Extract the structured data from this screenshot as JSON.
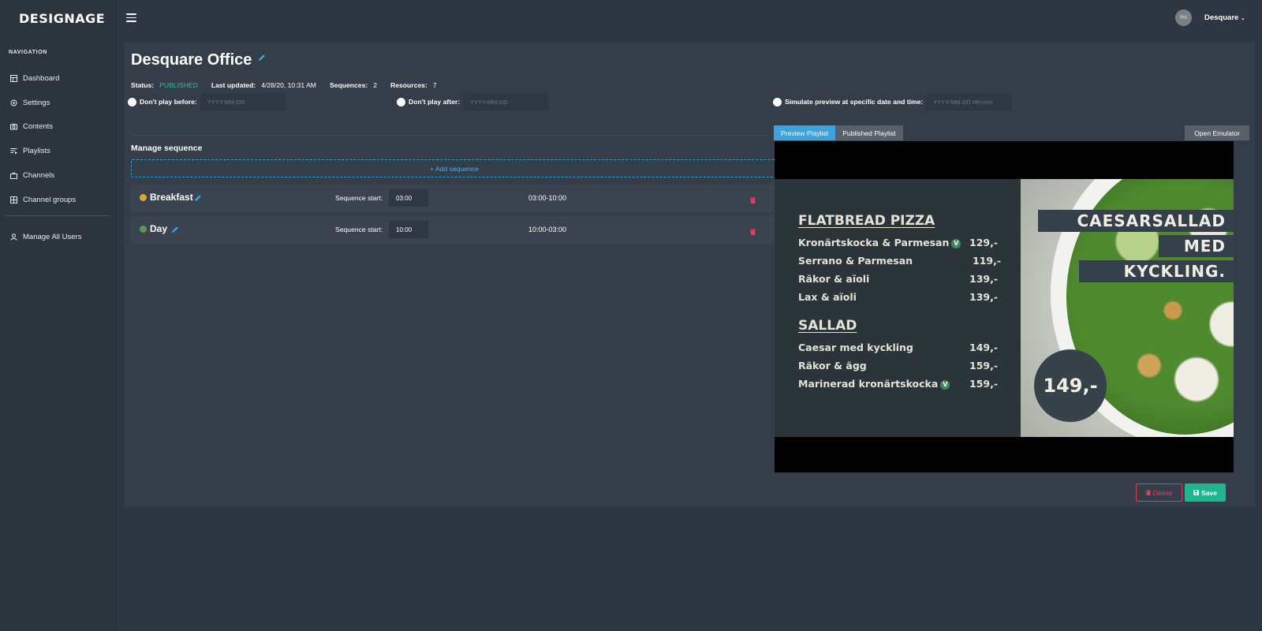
{
  "brand": {
    "logo": "DESIGNAGE"
  },
  "sidebar": {
    "heading": "NAVIGATION",
    "items": [
      {
        "label": "Dashboard",
        "icon": "dashboard-icon"
      },
      {
        "label": "Settings",
        "icon": "gear-icon"
      },
      {
        "label": "Contents",
        "icon": "camera-icon"
      },
      {
        "label": "Playlists",
        "icon": "playlist-icon"
      },
      {
        "label": "Channels",
        "icon": "tv-icon"
      },
      {
        "label": "Channel groups",
        "icon": "grid-icon"
      }
    ],
    "manage_users": "Manage All Users"
  },
  "topbar": {
    "avatar_initials": "RM",
    "user_name": "Desquare"
  },
  "page": {
    "title": "Desquare Office",
    "status_label": "Status:",
    "status_value": "PUBLISHED",
    "updated_label": "Last updated:",
    "updated_value": "4/28/20, 10:31 AM",
    "sequences_label": "Sequences:",
    "sequences_value": "2",
    "resources_label": "Resources:",
    "resources_value": "7",
    "before_label": "Don't play before:",
    "before_placeholder": "YYYY-MM-DD",
    "after_label": "Don't play after:",
    "after_placeholder": "YYYY-MM-DD",
    "simulate_label": "Simulate preview at specific date and time:",
    "simulate_placeholder": "YYYY-MM-DD HH:mm",
    "manage_title": "Manage sequence",
    "add_sequence": "+ Add sequence"
  },
  "sequences": [
    {
      "name": "Breakfast",
      "color": "#d9a830",
      "start_label": "Sequence start:",
      "start": "03:00",
      "range": "03:00-10:00"
    },
    {
      "name": "Day",
      "color": "#5b9a4e",
      "start_label": "Sequence start:",
      "start": "10:00",
      "range": "10:00-03:00"
    }
  ],
  "preview": {
    "tab_preview": "Preview Playlist",
    "tab_published": "Published Playlist",
    "open_emulator": "Open Emulator",
    "menu": {
      "heading1": "FLATBREAD PIZZA",
      "pizza": [
        {
          "name": "Kronärtskocka & Parmesan",
          "veg": "V",
          "price": "129,-"
        },
        {
          "name": "Serrano & Parmesan",
          "price": "119,-"
        },
        {
          "name": "Räkor & aïoli",
          "price": "139,-"
        },
        {
          "name": "Lax & aïoli",
          "price": "139,-"
        }
      ],
      "heading2": "SALLAD",
      "sallad": [
        {
          "name": "Caesar med kyckling",
          "price": "149,-"
        },
        {
          "name": "Räkor & ägg",
          "price": "159,-"
        },
        {
          "name": "Marinerad kronärtskocka",
          "veg": "V",
          "price": "159,-"
        }
      ],
      "banner1": "CAESARSALLAD",
      "banner2": "MED",
      "banner3": "KYCKLING.",
      "badge": "149,-"
    }
  },
  "actions": {
    "delete": "Delete",
    "save": "Save"
  },
  "colors": {
    "accent": "#3aa3e0",
    "published": "#28c59a",
    "danger": "#e0405e",
    "success": "#1fb58d"
  }
}
